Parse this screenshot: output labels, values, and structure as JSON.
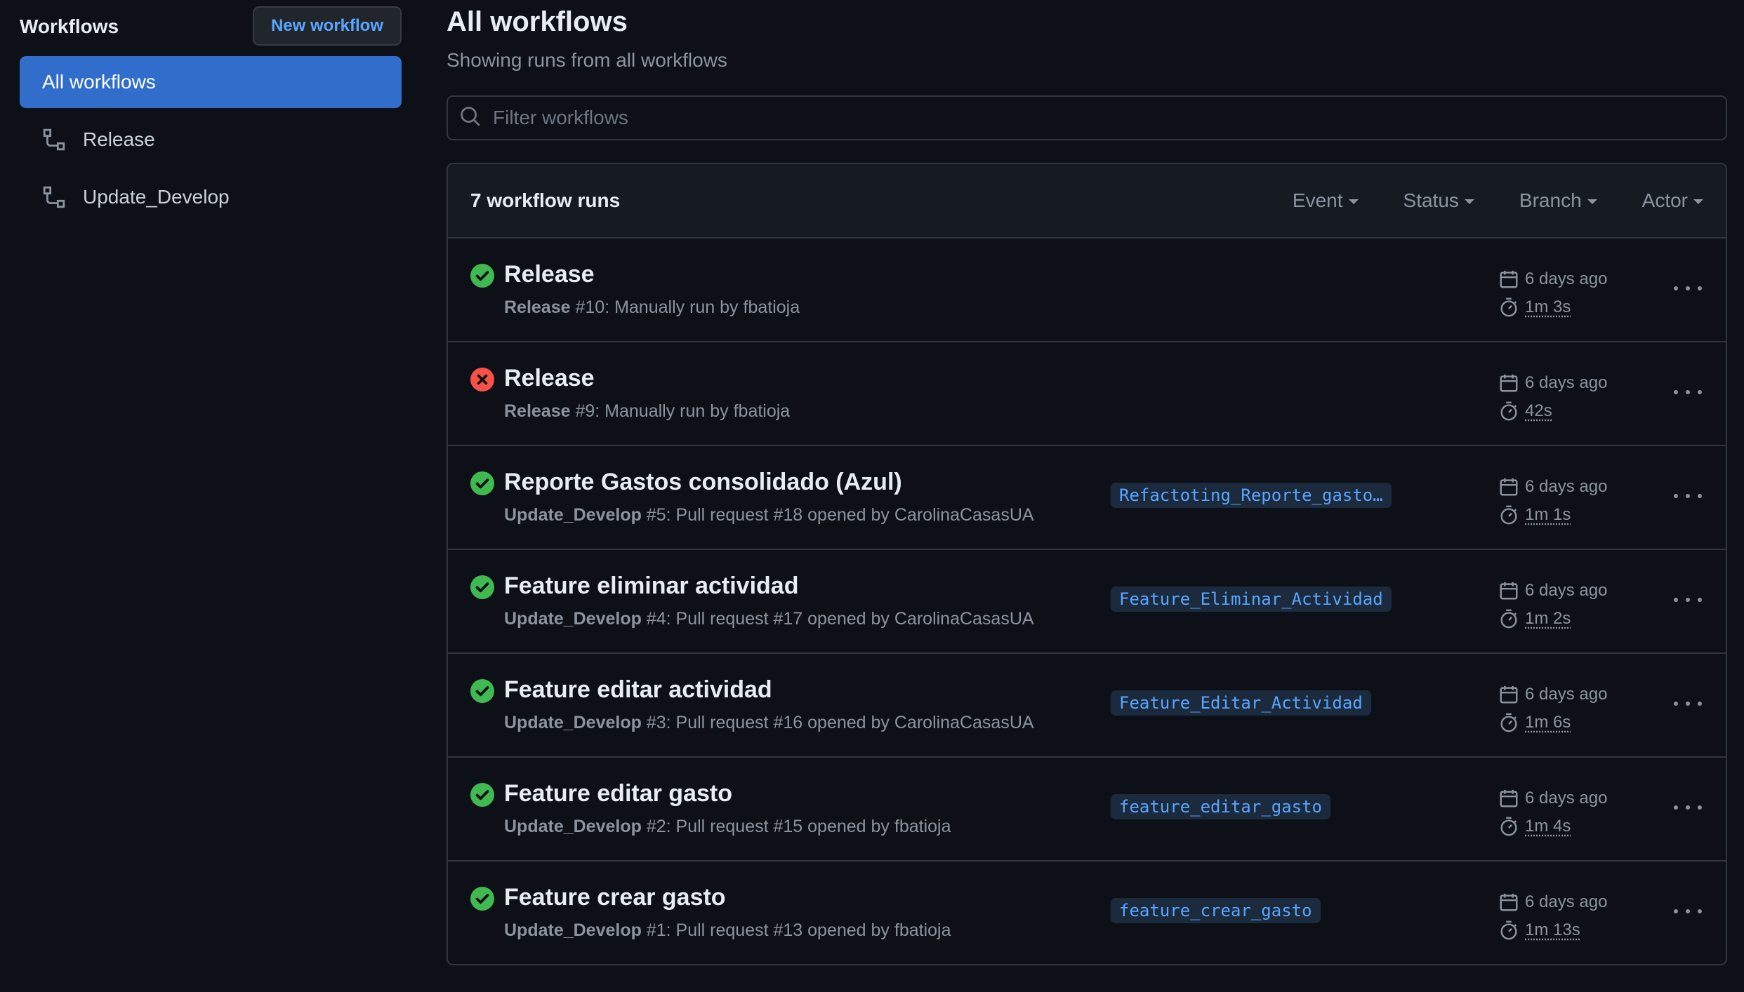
{
  "sidebar": {
    "title": "Workflows",
    "new_workflow_label": "New workflow",
    "items": [
      {
        "label": "All workflows",
        "active": true
      },
      {
        "label": "Release",
        "icon": "workflow-icon"
      },
      {
        "label": "Update_Develop",
        "icon": "workflow-icon"
      }
    ]
  },
  "main": {
    "title": "All workflows",
    "subtitle": "Showing runs from all workflows",
    "search": {
      "placeholder": "Filter workflows",
      "value": ""
    },
    "runs_count": "7 workflow runs",
    "filters": [
      "Event",
      "Status",
      "Branch",
      "Actor"
    ],
    "runs": [
      {
        "status": "success",
        "title": "Release",
        "workflow": "Release",
        "detail": " #10: Manually run by fbatioja",
        "branch": "",
        "time": "6 days ago",
        "duration": "1m 3s"
      },
      {
        "status": "failure",
        "title": "Release",
        "workflow": "Release",
        "detail": " #9: Manually run by fbatioja",
        "branch": "",
        "time": "6 days ago",
        "duration": "42s"
      },
      {
        "status": "success",
        "title": "Reporte Gastos consolidado (Azul)",
        "workflow": "Update_Develop",
        "detail": " #5: Pull request #18 opened by CarolinaCasasUA",
        "branch": "Refactoting_Reporte_gasto…",
        "time": "6 days ago",
        "duration": "1m 1s"
      },
      {
        "status": "success",
        "title": "Feature eliminar actividad",
        "workflow": "Update_Develop",
        "detail": " #4: Pull request #17 opened by CarolinaCasasUA",
        "branch": "Feature_Eliminar_Actividad",
        "time": "6 days ago",
        "duration": "1m 2s"
      },
      {
        "status": "success",
        "title": "Feature editar actividad",
        "workflow": "Update_Develop",
        "detail": " #3: Pull request #16 opened by CarolinaCasasUA",
        "branch": "Feature_Editar_Actividad",
        "time": "6 days ago",
        "duration": "1m 6s"
      },
      {
        "status": "success",
        "title": "Feature editar gasto",
        "workflow": "Update_Develop",
        "detail": " #2: Pull request #15 opened by fbatioja",
        "branch": "feature_editar_gasto",
        "time": "6 days ago",
        "duration": "1m 4s"
      },
      {
        "status": "success",
        "title": "Feature crear gasto",
        "workflow": "Update_Develop",
        "detail": " #1: Pull request #13 opened by fbatioja",
        "branch": "feature_crear_gasto",
        "time": "6 days ago",
        "duration": "1m 13s"
      }
    ]
  },
  "colors": {
    "accent": "#316dca",
    "success": "#3fb950",
    "failure": "#f85149",
    "link": "#58a6ff"
  }
}
